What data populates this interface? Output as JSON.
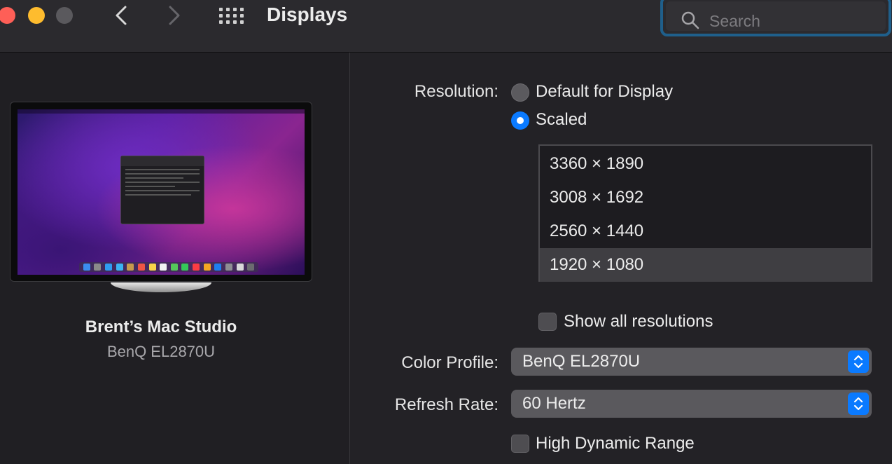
{
  "window": {
    "title": "Displays",
    "search_placeholder": "Search"
  },
  "sidebar": {
    "device_name": "Brent’s Mac Studio",
    "device_model": "BenQ EL2870U"
  },
  "resolution": {
    "label": "Resolution:",
    "option_default": "Default for Display",
    "option_scaled": "Scaled",
    "selected_option": "Scaled",
    "list": [
      "3360 × 1890",
      "3008 × 1692",
      "2560 × 1440",
      "1920 × 1080"
    ],
    "selected": "1920 × 1080"
  },
  "show_all": {
    "label": "Show all resolutions",
    "checked": false
  },
  "color_profile": {
    "label": "Color Profile:",
    "value": "BenQ EL2870U"
  },
  "refresh_rate": {
    "label": "Refresh Rate:",
    "value": "60 Hertz"
  },
  "hdr": {
    "label": "High Dynamic Range",
    "checked": false
  },
  "colors": {
    "accent": "#0a7aff",
    "close": "#fe5f57",
    "minimize": "#febc2e",
    "focus_ring": "#1f5f8b"
  }
}
